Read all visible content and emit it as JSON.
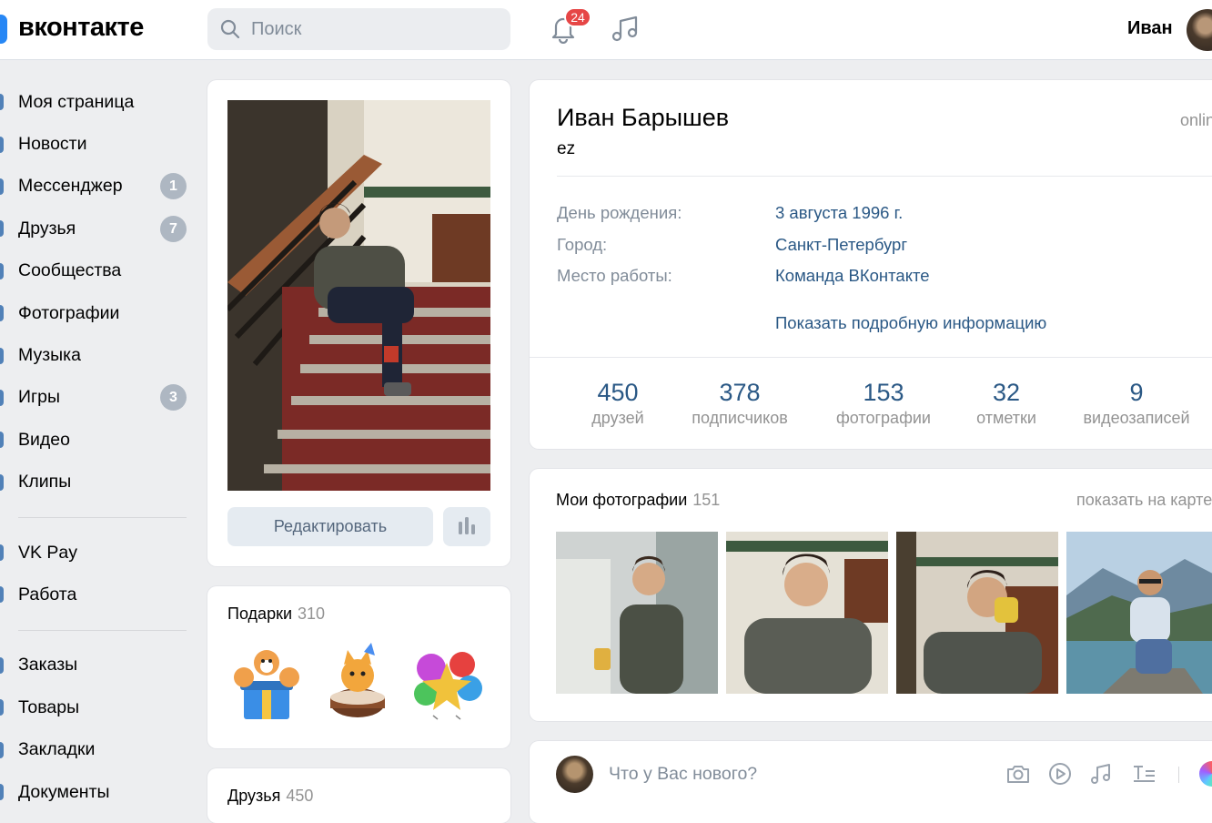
{
  "header": {
    "logo_text": "вконтакте",
    "search_placeholder": "Поиск",
    "notifications_count": "24",
    "user_name": "Иван"
  },
  "sidebar": {
    "items": [
      {
        "label": "Моя страница",
        "badge": ""
      },
      {
        "label": "Новости",
        "badge": ""
      },
      {
        "label": "Мессенджер",
        "badge": "1"
      },
      {
        "label": "Друзья",
        "badge": "7"
      },
      {
        "label": "Сообщества",
        "badge": ""
      },
      {
        "label": "Фотографии",
        "badge": ""
      },
      {
        "label": "Музыка",
        "badge": ""
      },
      {
        "label": "Игры",
        "badge": "3"
      },
      {
        "label": "Видео",
        "badge": ""
      },
      {
        "label": "Клипы",
        "badge": ""
      }
    ],
    "items2": [
      {
        "label": "VK Pay"
      },
      {
        "label": "Работа"
      }
    ],
    "items3": [
      {
        "label": "Заказы"
      },
      {
        "label": "Товары"
      },
      {
        "label": "Закладки"
      },
      {
        "label": "Документы"
      }
    ]
  },
  "photo_card": {
    "edit_label": "Редактировать"
  },
  "gifts": {
    "title": "Подарки",
    "count": "310"
  },
  "friends": {
    "title": "Друзья",
    "count": "450"
  },
  "profile": {
    "name": "Иван Барышев",
    "status": "ez",
    "online": "online",
    "info": [
      {
        "label": "День рождения:",
        "value": "3 августа 1996 г."
      },
      {
        "label": "Город:",
        "value": "Санкт-Петербург"
      },
      {
        "label": "Место работы:",
        "value": "Команда ВКонтакте"
      }
    ],
    "more_info": "Показать подробную информацию",
    "counters": [
      {
        "num": "450",
        "label": "друзей"
      },
      {
        "num": "378",
        "label": "подписчиков"
      },
      {
        "num": "153",
        "label": "фотографии"
      },
      {
        "num": "32",
        "label": "отметки"
      },
      {
        "num": "9",
        "label": "видеозаписей"
      }
    ]
  },
  "photos": {
    "title": "Мои фотографии",
    "count": "151",
    "show_on_map": "показать на карте"
  },
  "post": {
    "placeholder": "Что у Вас нового?"
  },
  "colors": {
    "accent": "#2a5885",
    "brand": "#2787f5",
    "badge_red": "#e64646",
    "badge_gray": "#aeb7c2"
  }
}
